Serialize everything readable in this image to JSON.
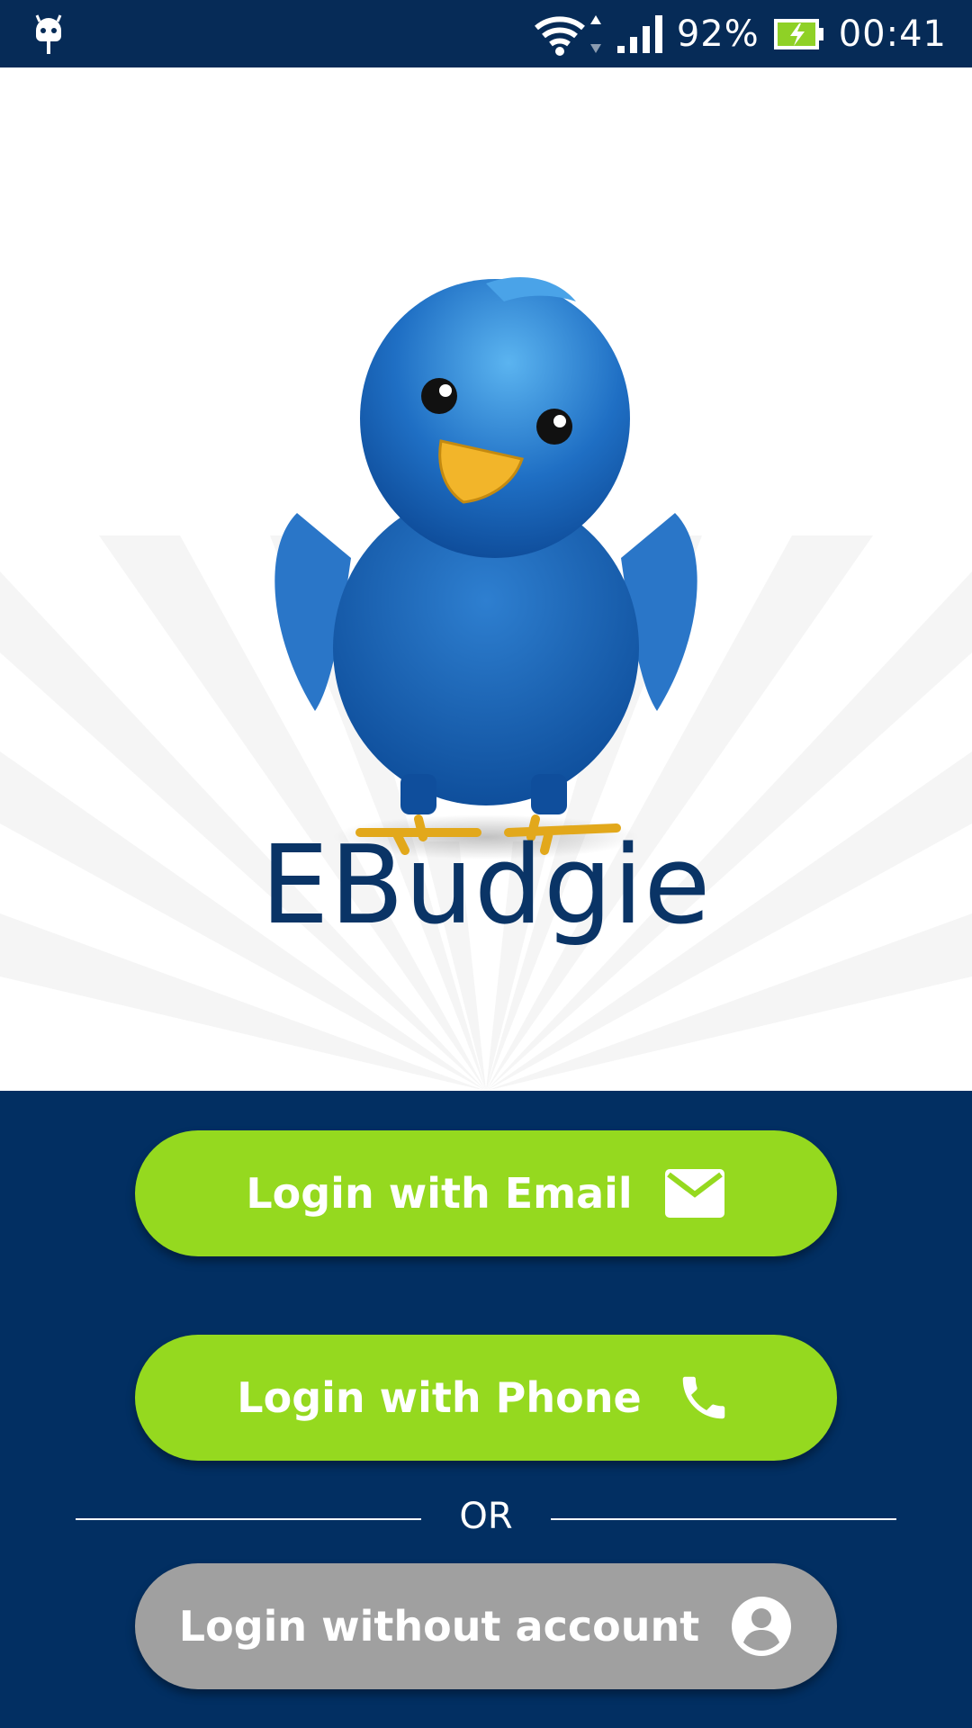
{
  "status_bar": {
    "battery_percent": "92%",
    "time": "00:41",
    "icons": [
      "android-icon",
      "wifi-icon",
      "signal-icon",
      "battery-charging-icon"
    ]
  },
  "app": {
    "title": "EBudgie",
    "logo_icon": "bird-icon"
  },
  "buttons": {
    "email": {
      "label": "Login with Email",
      "icon": "mail-icon"
    },
    "phone": {
      "label": "Login with Phone",
      "icon": "phone-icon"
    },
    "guest": {
      "label": "Login without account",
      "icon": "account-icon"
    }
  },
  "divider": {
    "text": "OR"
  },
  "colors": {
    "status_bar_bg": "#062b57",
    "panel_bg": "#022f62",
    "button_green": "#95d91f",
    "button_gray": "#a0a0a0",
    "title_color": "#0a3466"
  }
}
